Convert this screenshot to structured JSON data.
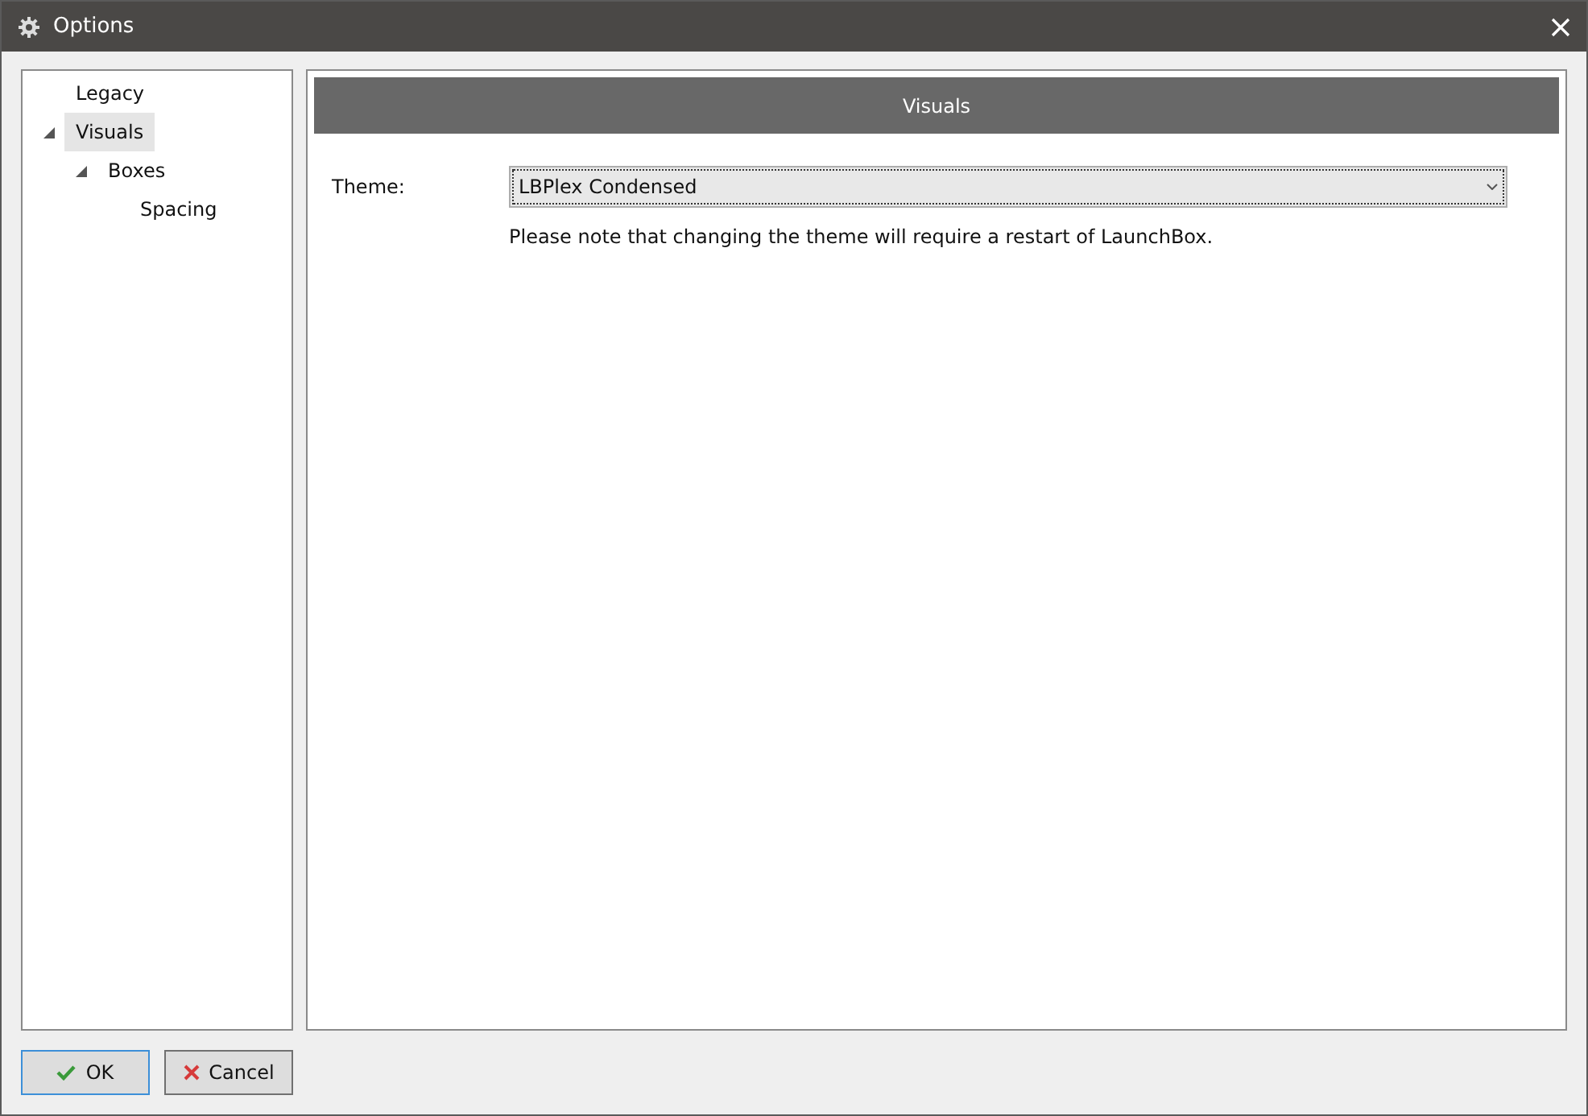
{
  "window": {
    "title": "Options"
  },
  "tree": [
    {
      "label": "Legacy",
      "selected": false
    },
    {
      "label": "Visuals",
      "selected": true,
      "expanded": true,
      "children": [
        {
          "label": "Boxes",
          "selected": false,
          "expanded": true,
          "children": [
            {
              "label": "Spacing",
              "selected": false
            }
          ]
        }
      ]
    }
  ],
  "panel": {
    "title": "Visuals",
    "theme_label": "Theme:",
    "theme_value": "LBPlex Condensed",
    "note": "Please note that changing the theme will require a restart of LaunchBox."
  },
  "buttons": [
    {
      "kind": "ok",
      "label": "OK"
    },
    {
      "kind": "cancel",
      "label": "Cancel"
    }
  ]
}
